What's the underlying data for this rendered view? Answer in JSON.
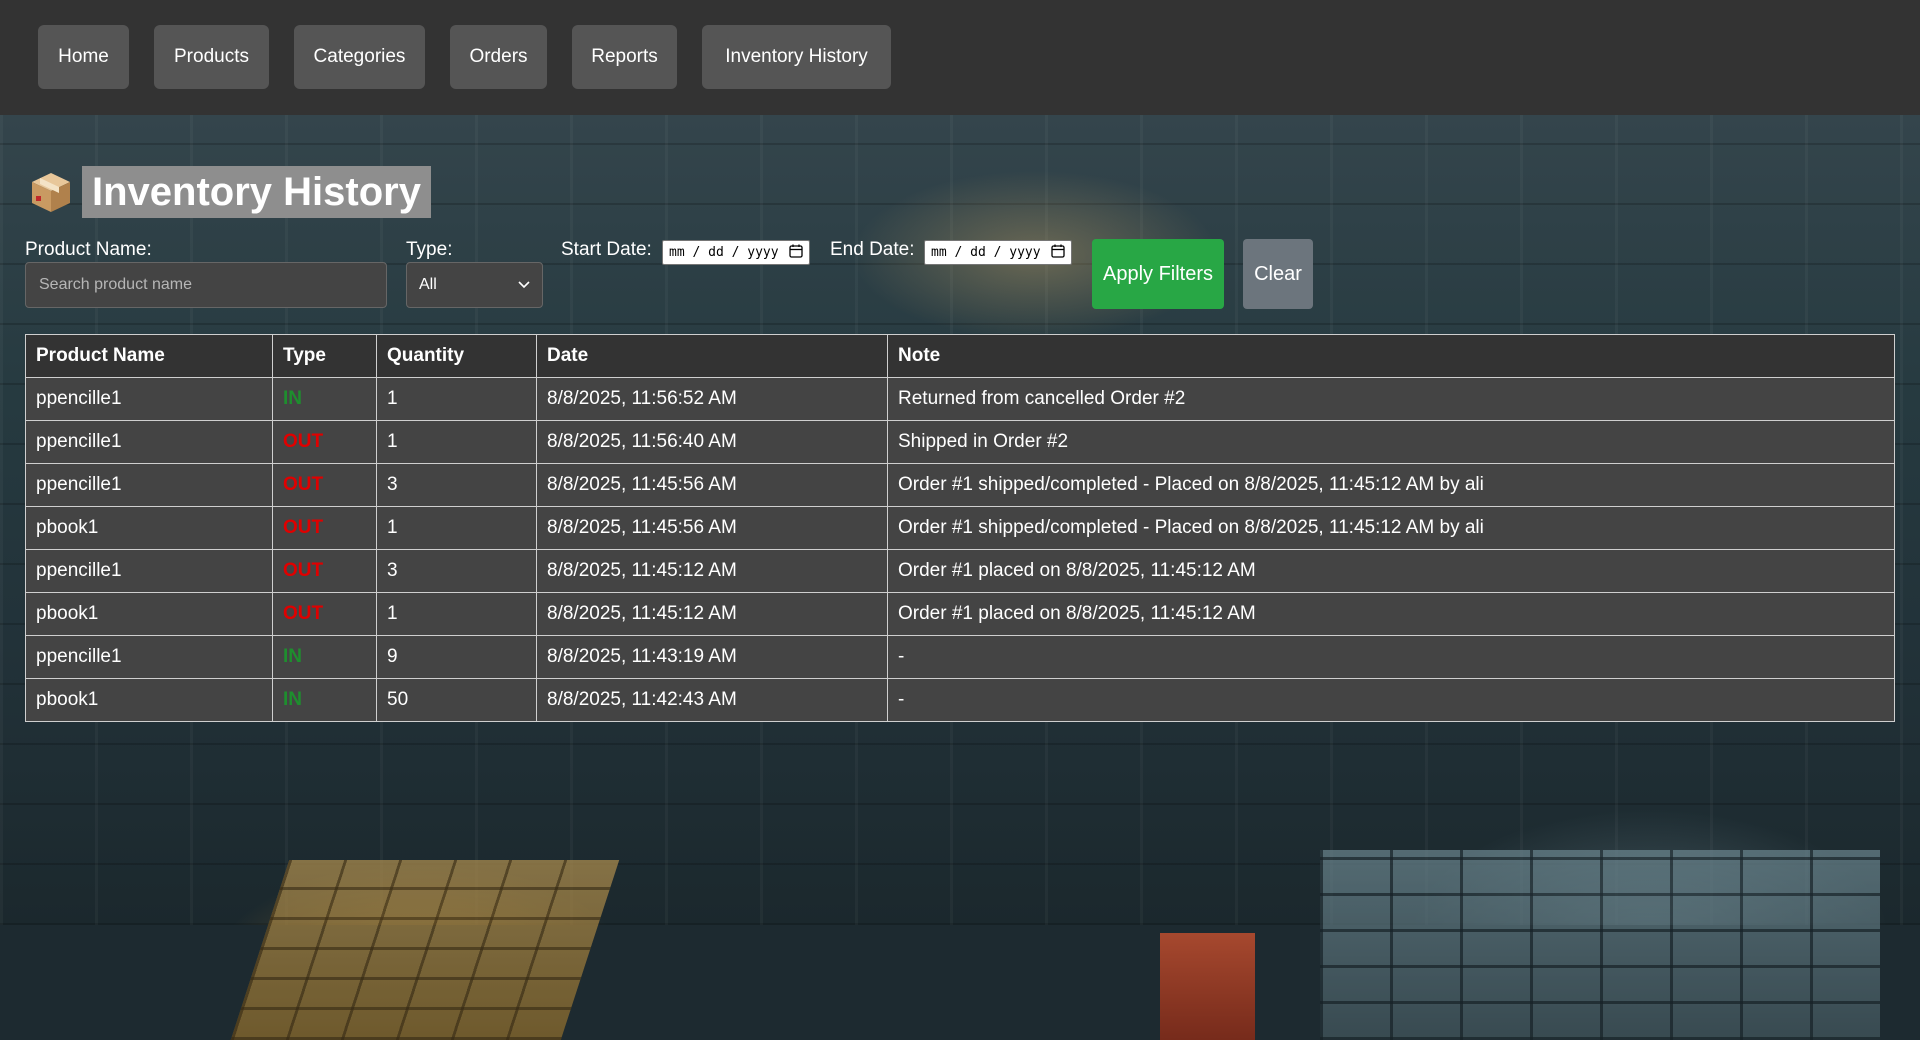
{
  "nav": {
    "items": [
      {
        "label": "Home"
      },
      {
        "label": "Products"
      },
      {
        "label": "Categories"
      },
      {
        "label": "Orders"
      },
      {
        "label": "Reports"
      },
      {
        "label": "Inventory History"
      }
    ]
  },
  "page": {
    "title_icon": "package-icon",
    "title": "Inventory History"
  },
  "filters": {
    "product_name_label": "Product Name:",
    "product_name_placeholder": "Search product name",
    "product_name_value": "",
    "type_label": "Type:",
    "type_value": "All",
    "start_date_label": "Start Date:",
    "start_date_placeholder": "mm / dd / yyyy",
    "end_date_label": "End Date:",
    "end_date_placeholder": "mm / dd / yyyy",
    "apply_label": "Apply Filters",
    "clear_label": "Clear"
  },
  "colors": {
    "apply": "#28a745",
    "clear": "#6c757d",
    "type_in": "#1e8e2e",
    "type_out": "#e00000"
  },
  "table": {
    "headers": [
      "Product Name",
      "Type",
      "Quantity",
      "Date",
      "Note"
    ],
    "rows": [
      {
        "product": "ppencille1",
        "type": "IN",
        "quantity": "1",
        "date": "8/8/2025, 11:56:52 AM",
        "note": "Returned from cancelled Order #2"
      },
      {
        "product": "ppencille1",
        "type": "OUT",
        "quantity": "1",
        "date": "8/8/2025, 11:56:40 AM",
        "note": "Shipped in Order #2"
      },
      {
        "product": "ppencille1",
        "type": "OUT",
        "quantity": "3",
        "date": "8/8/2025, 11:45:56 AM",
        "note": "Order #1 shipped/completed - Placed on 8/8/2025, 11:45:12 AM by ali"
      },
      {
        "product": "pbook1",
        "type": "OUT",
        "quantity": "1",
        "date": "8/8/2025, 11:45:56 AM",
        "note": "Order #1 shipped/completed - Placed on 8/8/2025, 11:45:12 AM by ali"
      },
      {
        "product": "ppencille1",
        "type": "OUT",
        "quantity": "3",
        "date": "8/8/2025, 11:45:12 AM",
        "note": "Order #1 placed on 8/8/2025, 11:45:12 AM"
      },
      {
        "product": "pbook1",
        "type": "OUT",
        "quantity": "1",
        "date": "8/8/2025, 11:45:12 AM",
        "note": "Order #1 placed on 8/8/2025, 11:45:12 AM"
      },
      {
        "product": "ppencille1",
        "type": "IN",
        "quantity": "9",
        "date": "8/8/2025, 11:43:19 AM",
        "note": "-"
      },
      {
        "product": "pbook1",
        "type": "IN",
        "quantity": "50",
        "date": "8/8/2025, 11:42:43 AM",
        "note": "-"
      }
    ]
  }
}
